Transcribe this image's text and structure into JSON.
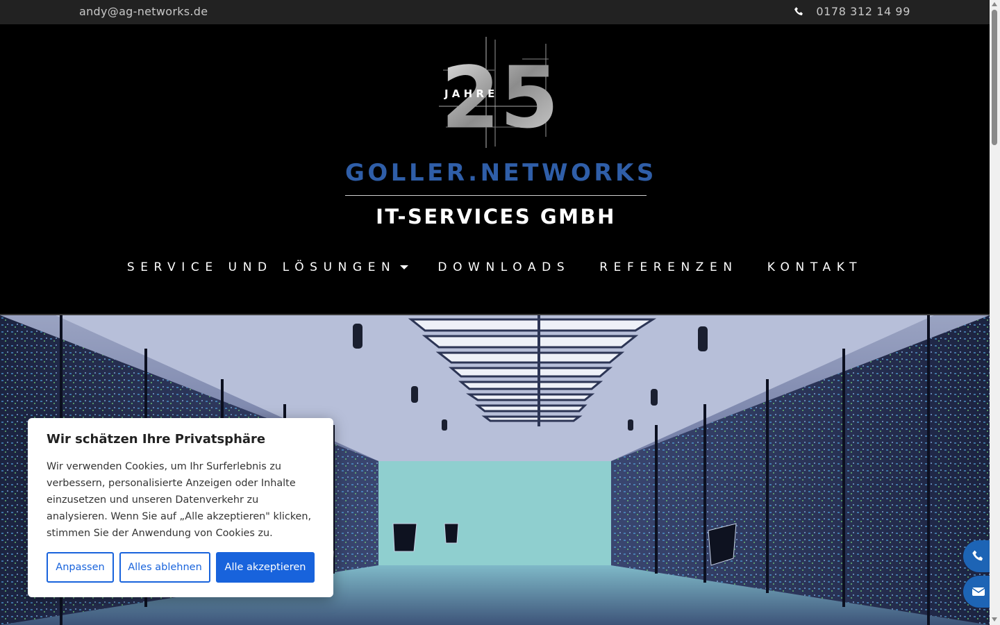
{
  "topbar": {
    "email": "andy@ag-networks.de",
    "phone": "0178 312 14 99"
  },
  "logo": {
    "number": "25",
    "word": "J A H R E"
  },
  "brand": {
    "name": "GOLLER.NETWORKS",
    "tagline": "IT-SERVICES GMBH",
    "color": "#2f5ea8"
  },
  "nav": {
    "items": [
      {
        "label": "SERVICE UND LÖSUNGEN",
        "has_dropdown": true
      },
      {
        "label": "DOWNLOADS"
      },
      {
        "label": "REFERENZEN"
      },
      {
        "label": "KONTAKT"
      }
    ]
  },
  "cookie": {
    "title": "Wir schätzen Ihre Privatsphäre",
    "text": "Wir verwenden Cookies, um Ihr Surferlebnis zu verbessern, personalisierte Anzeigen oder Inhalte einzusetzen und unseren Datenverkehr zu analysieren. Wenn Sie auf „Alle akzeptieren\" klicken, stimmen Sie der Anwendung von Cookies zu.",
    "customize_label": "Anpassen",
    "reject_label": "Alles ablehnen",
    "accept_label": "Alle akzeptieren",
    "accent": "#1863dc"
  },
  "floating": {
    "phone_icon": "phone-icon",
    "mail_icon": "envelope-icon",
    "color": "#1d64b5"
  }
}
